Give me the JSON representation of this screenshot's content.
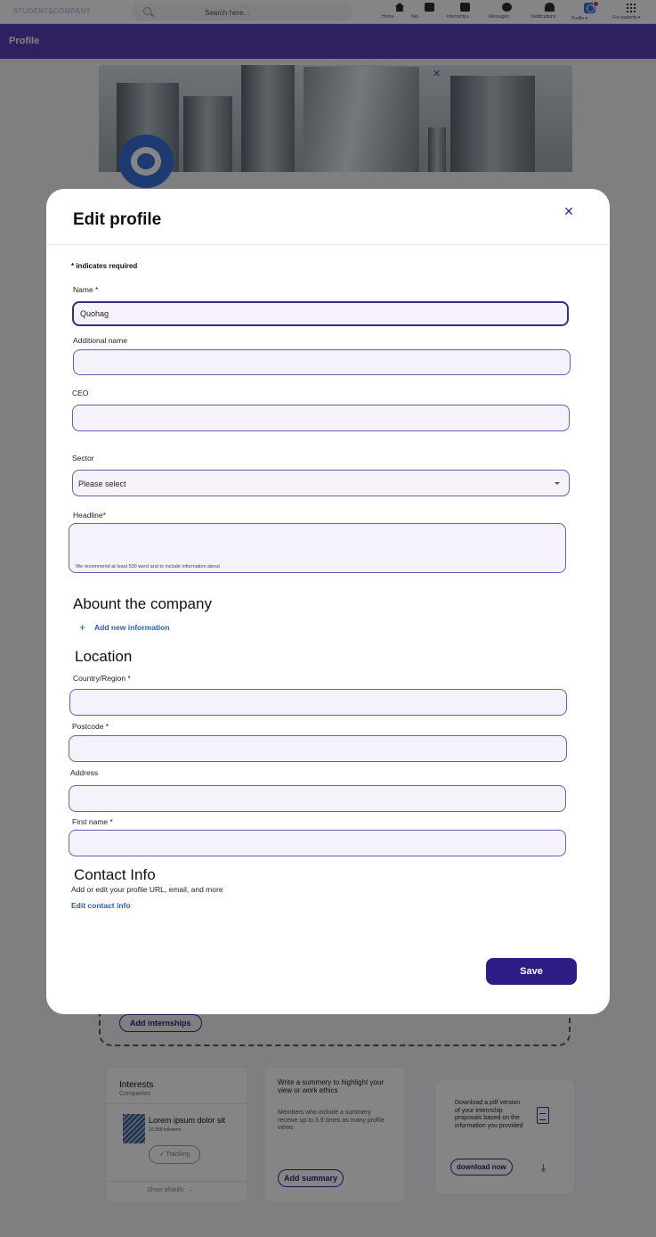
{
  "topbar": {
    "brand": "STUDENT&COMPANY",
    "search_placeholder": "Search here...",
    "nav": [
      {
        "label": "Home",
        "icon": "home-icon"
      },
      {
        "label": "Net",
        "icon": "network-icon"
      },
      {
        "label": "Internships",
        "icon": "briefcase-icon"
      },
      {
        "label": "Messages",
        "icon": "chat-icon"
      },
      {
        "label": "Notifications",
        "icon": "bell-icon"
      },
      {
        "label": "Profile",
        "icon": "profile-icon"
      },
      {
        "label": "For students",
        "icon": "grid-icon"
      }
    ]
  },
  "profile_bar": {
    "title": "Profile"
  },
  "background": {
    "add_internships": "Add internships",
    "interests": {
      "title": "Interests",
      "tab": "Companies",
      "item_name": "Lorem ipsum dolor sit",
      "item_followers": "10.258 followers",
      "tracking": "Tracking",
      "show_all": "Show allskills"
    },
    "summary": {
      "headline": "Write a summery to highlight your view or work ethics",
      "text": "Members who include a summery receive up to 3.9 times as many profile views",
      "button": "Add summary"
    },
    "download": {
      "text": "Download a pdf version of your internship proposals based on the information you provided",
      "button": "download now"
    }
  },
  "modal": {
    "title": "Edit profile",
    "required_note": "* indicates required",
    "name_label": "Name *",
    "name_value": "Quohag",
    "additional_name_label": "Additional  name",
    "ceo_label": "CEO",
    "sector_label": "Sector",
    "sector_value": "Please select",
    "headline_label": "Headline*",
    "headline_hint": "We recommend at least 500 word and to  include information about",
    "about_heading": "Abount the company",
    "add_new_info": "Add new information",
    "location_heading": "Location",
    "country_label": "Country/Region *",
    "postcode_label": "Postcode *",
    "address_label": "Address",
    "first_name_label": "First name *",
    "contact_heading": "Contact Info",
    "contact_desc": "Add or edit your profile URL, email, and more",
    "edit_contact": "Edit contact info",
    "save": "Save"
  }
}
